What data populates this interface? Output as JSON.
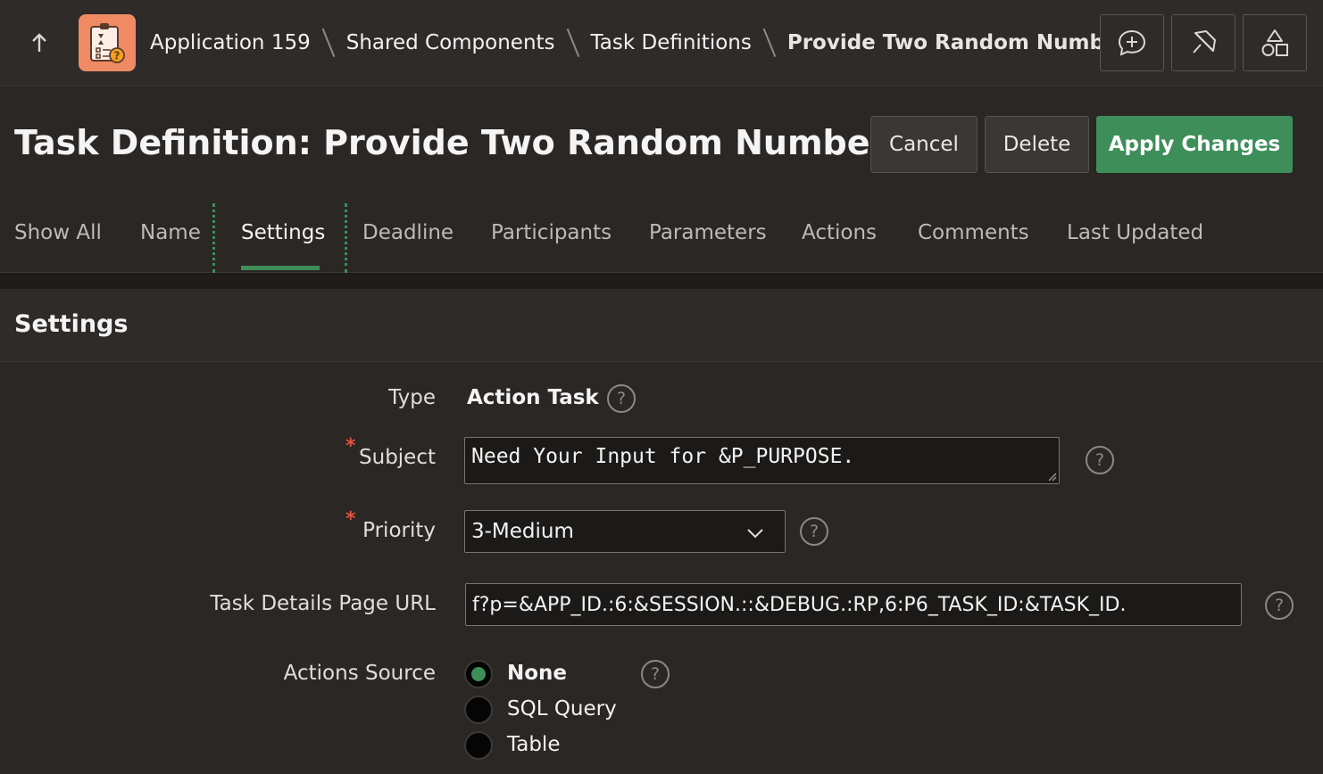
{
  "breadcrumb": {
    "app": "Application 159",
    "shared": "Shared Components",
    "task_defs": "Task Definitions",
    "current": "Provide Two Random Numbers"
  },
  "toolbar": {
    "feedback_icon": "chat-plus-icon",
    "sticky_icon": "pin-icon",
    "shapes_icon": "shapes-icon"
  },
  "page": {
    "title": "Task Definition: Provide Two Random Numbers",
    "cancel_label": "Cancel",
    "delete_label": "Delete",
    "apply_label": "Apply Changes"
  },
  "tabs": [
    {
      "label": "Show All"
    },
    {
      "label": "Name"
    },
    {
      "label": "Settings"
    },
    {
      "label": "Deadline"
    },
    {
      "label": "Participants"
    },
    {
      "label": "Parameters"
    },
    {
      "label": "Actions"
    },
    {
      "label": "Comments"
    },
    {
      "label": "Last Updated"
    }
  ],
  "settings": {
    "section_title": "Settings",
    "type_label": "Type",
    "type_value": "Action Task",
    "subject_label": "Subject",
    "subject_value": "Need Your Input for &P_PURPOSE.",
    "priority_label": "Priority",
    "priority_value": "3-Medium",
    "url_label": "Task Details Page URL",
    "url_value": "f?p=&APP_ID.:6:&SESSION.::&DEBUG.:RP,6:P6_TASK_ID:&TASK_ID.",
    "actions_source_label": "Actions Source",
    "actions_source_options": [
      {
        "label": "None",
        "checked": true
      },
      {
        "label": "SQL Query",
        "checked": false
      },
      {
        "label": "Table",
        "checked": false
      }
    ],
    "required_mark": "*",
    "help_glyph": "?"
  },
  "colors": {
    "accent": "#3e8e5a",
    "background": "#2a2725",
    "required": "#e0533c",
    "app_icon": "#f08a65"
  }
}
